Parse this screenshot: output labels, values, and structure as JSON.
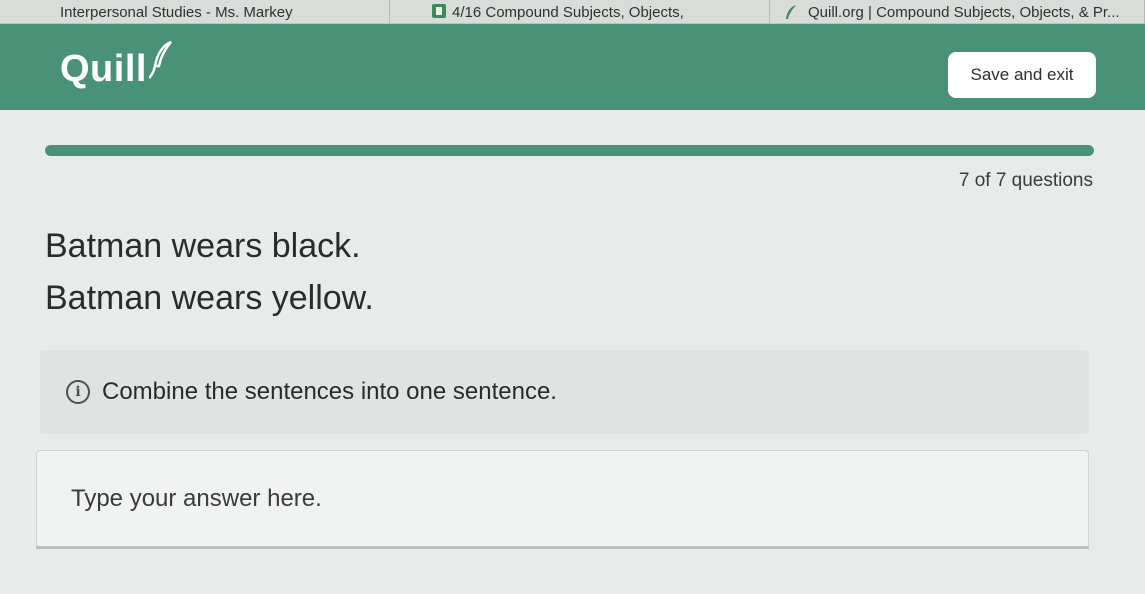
{
  "browser": {
    "tabs": [
      {
        "title": "Interpersonal Studies - Ms. Markey",
        "icon": "classroom-icon"
      },
      {
        "title": "4/16 Compound Subjects, Objects,",
        "icon": "doc-icon"
      },
      {
        "title": "Quill.org | Compound Subjects, Objects, & Pr...",
        "icon": "quill-feather-icon"
      }
    ]
  },
  "header": {
    "logo": "Quill",
    "save_label": "Save and exit"
  },
  "progress": {
    "fraction": 1.0,
    "label": "7 of 7 questions"
  },
  "prompt": {
    "sentences": [
      "Batman wears black.",
      "Batman wears yellow."
    ]
  },
  "instruction": {
    "text": "Combine the sentences into one sentence.",
    "icon": "info-icon"
  },
  "answer": {
    "placeholder": "Type your answer here.",
    "value": ""
  },
  "colors": {
    "brand": "#4a9277",
    "background": "#e7ebe9"
  }
}
